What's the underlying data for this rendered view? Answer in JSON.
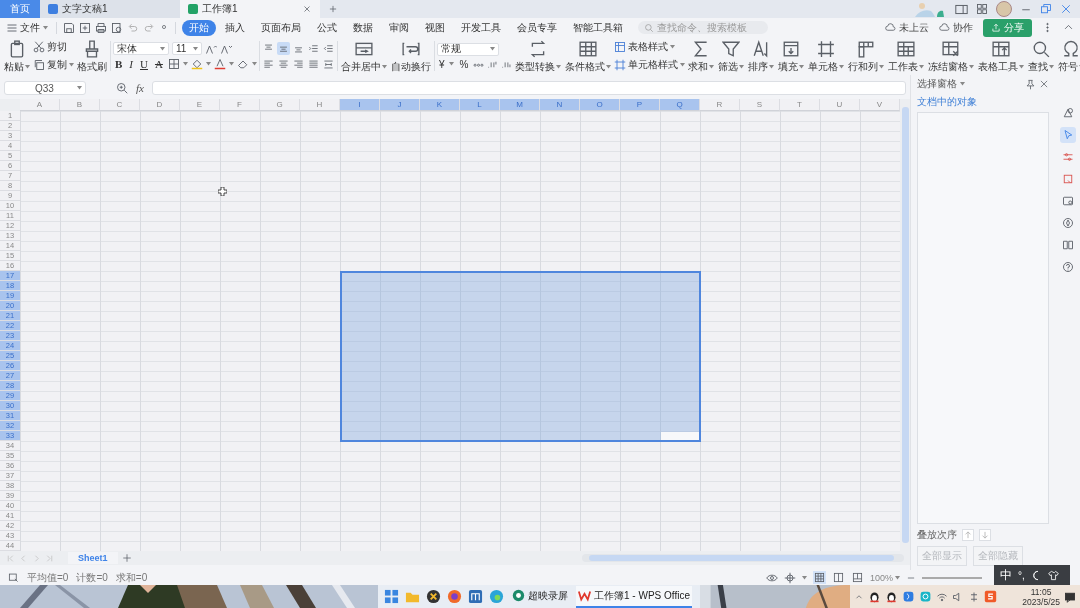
{
  "tabs": [
    {
      "kind": "home",
      "label": "首页",
      "selected": false
    },
    {
      "kind": "doc",
      "label": "文字文稿1",
      "selected": false
    },
    {
      "kind": "sheet",
      "label": "工作簿1",
      "selected": true
    }
  ],
  "menu": {
    "file": "文件",
    "tabs": [
      {
        "label": "开始",
        "selected": true
      },
      {
        "label": "插入",
        "selected": false
      },
      {
        "label": "页面布局",
        "selected": false
      },
      {
        "label": "公式",
        "selected": false
      },
      {
        "label": "数据",
        "selected": false
      },
      {
        "label": "审阅",
        "selected": false
      },
      {
        "label": "视图",
        "selected": false
      },
      {
        "label": "开发工具",
        "selected": false
      },
      {
        "label": "会员专享",
        "selected": false
      },
      {
        "label": "智能工具箱",
        "selected": false
      }
    ],
    "search": {
      "placeholder": "查找命令、搜索模板"
    },
    "actions": [
      {
        "kind": "link",
        "label": "未上云"
      },
      {
        "kind": "link",
        "label": "协作"
      },
      {
        "kind": "primary",
        "label": "分享"
      }
    ]
  },
  "ribbon": [
    {
      "kind": "large",
      "label": "粘贴",
      "caret": true
    },
    {
      "kind": "stack",
      "items": [
        {
          "label": "剪切",
          "caret": false
        },
        {
          "label": "复制",
          "caret": true
        }
      ]
    },
    {
      "kind": "large",
      "label": "格式刷",
      "caret": false
    },
    {
      "kind": "font",
      "font": "宋体",
      "size": "11",
      "styles": [
        "B",
        "I",
        "U",
        "A"
      ]
    },
    {
      "kind": "align",
      "buttons": [
        {
          "selected": false
        },
        {
          "selected": true
        },
        {
          "selected": false
        },
        {
          "selected": false
        },
        {
          "selected": false
        },
        {
          "selected": false
        },
        {
          "selected": false
        },
        {
          "selected": false
        },
        {
          "selected": false
        },
        {
          "selected": false
        }
      ]
    },
    {
      "kind": "large",
      "label": "合并居中",
      "caret": true
    },
    {
      "kind": "large",
      "label": "自动换行",
      "caret": false
    },
    {
      "kind": "number",
      "format": "常规",
      "symbols": [
        "¥",
        "%"
      ]
    },
    {
      "kind": "large",
      "label": "类型转换",
      "caret": true
    },
    {
      "kind": "large",
      "label": "条件格式",
      "caret": true
    },
    {
      "kind": "stack",
      "items": [
        {
          "label": "表格样式",
          "caret": true
        },
        {
          "label": "单元格样式",
          "caret": true
        }
      ]
    },
    {
      "kind": "large",
      "label": "求和",
      "caret": true
    },
    {
      "kind": "large",
      "label": "筛选",
      "caret": true
    },
    {
      "kind": "large",
      "label": "排序",
      "caret": true
    },
    {
      "kind": "large",
      "label": "填充",
      "caret": true
    },
    {
      "kind": "large",
      "label": "单元格",
      "caret": true
    },
    {
      "kind": "large",
      "label": "行和列",
      "caret": true
    },
    {
      "kind": "large",
      "label": "工作表",
      "caret": true
    },
    {
      "kind": "large",
      "label": "冻结窗格",
      "caret": true
    },
    {
      "kind": "large",
      "label": "表格工具",
      "caret": true
    },
    {
      "kind": "large",
      "label": "查找",
      "caret": true
    },
    {
      "kind": "large",
      "label": "符号",
      "caret": true
    }
  ],
  "formula_bar": {
    "name_box": "Q33",
    "fx": "fx"
  },
  "columns": [
    {
      "label": "A",
      "selected": false
    },
    {
      "label": "B",
      "selected": false
    },
    {
      "label": "C",
      "selected": false
    },
    {
      "label": "D",
      "selected": false
    },
    {
      "label": "E",
      "selected": false
    },
    {
      "label": "F",
      "selected": false
    },
    {
      "label": "G",
      "selected": false
    },
    {
      "label": "H",
      "selected": false
    },
    {
      "label": "I",
      "selected": true
    },
    {
      "label": "J",
      "selected": true
    },
    {
      "label": "K",
      "selected": true
    },
    {
      "label": "L",
      "selected": true
    },
    {
      "label": "M",
      "selected": true
    },
    {
      "label": "N",
      "selected": true
    },
    {
      "label": "O",
      "selected": true
    },
    {
      "label": "P",
      "selected": true
    },
    {
      "label": "Q",
      "selected": true
    },
    {
      "label": "R",
      "selected": false
    },
    {
      "label": "S",
      "selected": false
    },
    {
      "label": "T",
      "selected": false
    },
    {
      "label": "U",
      "selected": false
    },
    {
      "label": "V",
      "selected": false
    }
  ],
  "rows": [
    {
      "label": "1",
      "selected": false
    },
    {
      "label": "2",
      "selected": false
    },
    {
      "label": "3",
      "selected": false
    },
    {
      "label": "4",
      "selected": false
    },
    {
      "label": "5",
      "selected": false
    },
    {
      "label": "6",
      "selected": false
    },
    {
      "label": "7",
      "selected": false
    },
    {
      "label": "8",
      "selected": false
    },
    {
      "label": "9",
      "selected": false
    },
    {
      "label": "10",
      "selected": false
    },
    {
      "label": "11",
      "selected": false
    },
    {
      "label": "12",
      "selected": false
    },
    {
      "label": "13",
      "selected": false
    },
    {
      "label": "14",
      "selected": false
    },
    {
      "label": "15",
      "selected": false
    },
    {
      "label": "16",
      "selected": false
    },
    {
      "label": "17",
      "selected": true
    },
    {
      "label": "18",
      "selected": true
    },
    {
      "label": "19",
      "selected": true
    },
    {
      "label": "20",
      "selected": true
    },
    {
      "label": "21",
      "selected": true
    },
    {
      "label": "22",
      "selected": true
    },
    {
      "label": "23",
      "selected": true
    },
    {
      "label": "24",
      "selected": true
    },
    {
      "label": "25",
      "selected": true
    },
    {
      "label": "26",
      "selected": true
    },
    {
      "label": "27",
      "selected": true
    },
    {
      "label": "28",
      "selected": true
    },
    {
      "label": "29",
      "selected": true
    },
    {
      "label": "30",
      "selected": true
    },
    {
      "label": "31",
      "selected": true
    },
    {
      "label": "32",
      "selected": true
    },
    {
      "label": "33",
      "selected": true
    },
    {
      "label": "34",
      "selected": false
    },
    {
      "label": "35",
      "selected": false
    },
    {
      "label": "36",
      "selected": false
    },
    {
      "label": "37",
      "selected": false
    },
    {
      "label": "38",
      "selected": false
    },
    {
      "label": "39",
      "selected": false
    },
    {
      "label": "40",
      "selected": false
    },
    {
      "label": "41",
      "selected": false
    },
    {
      "label": "42",
      "selected": false
    },
    {
      "label": "43",
      "selected": false
    },
    {
      "label": "44",
      "selected": false
    }
  ],
  "sheets": [
    {
      "label": "Sheet1",
      "selected": true
    }
  ],
  "side_panel": {
    "title": "选择窗格",
    "subtitle": "文档中的对象",
    "order_label": "叠放次序",
    "buttons": [
      {
        "label": "全部显示",
        "disabled": true
      },
      {
        "label": "全部隐藏",
        "disabled": true
      }
    ]
  },
  "tool_strip": [
    {
      "selected": false
    },
    {
      "selected": true
    },
    {
      "selected": false
    },
    {
      "selected": false
    },
    {
      "selected": false
    },
    {
      "selected": false
    },
    {
      "selected": false
    },
    {
      "selected": false
    }
  ],
  "status_bar": {
    "stats": [
      "平均值=0",
      "计数=0",
      "求和=0"
    ],
    "views": [
      {
        "selected": true
      },
      {
        "selected": false
      },
      {
        "selected": false
      }
    ],
    "zoom": "100%"
  },
  "ime": {
    "label": "中",
    "marks": "°,"
  },
  "taskbar": {
    "apps": [
      {
        "label": "超映录屏",
        "selected": false
      },
      {
        "label": "工作簿1 - WPS Office",
        "selected": true
      }
    ],
    "time": "11:05",
    "date": "2023/5/25"
  }
}
